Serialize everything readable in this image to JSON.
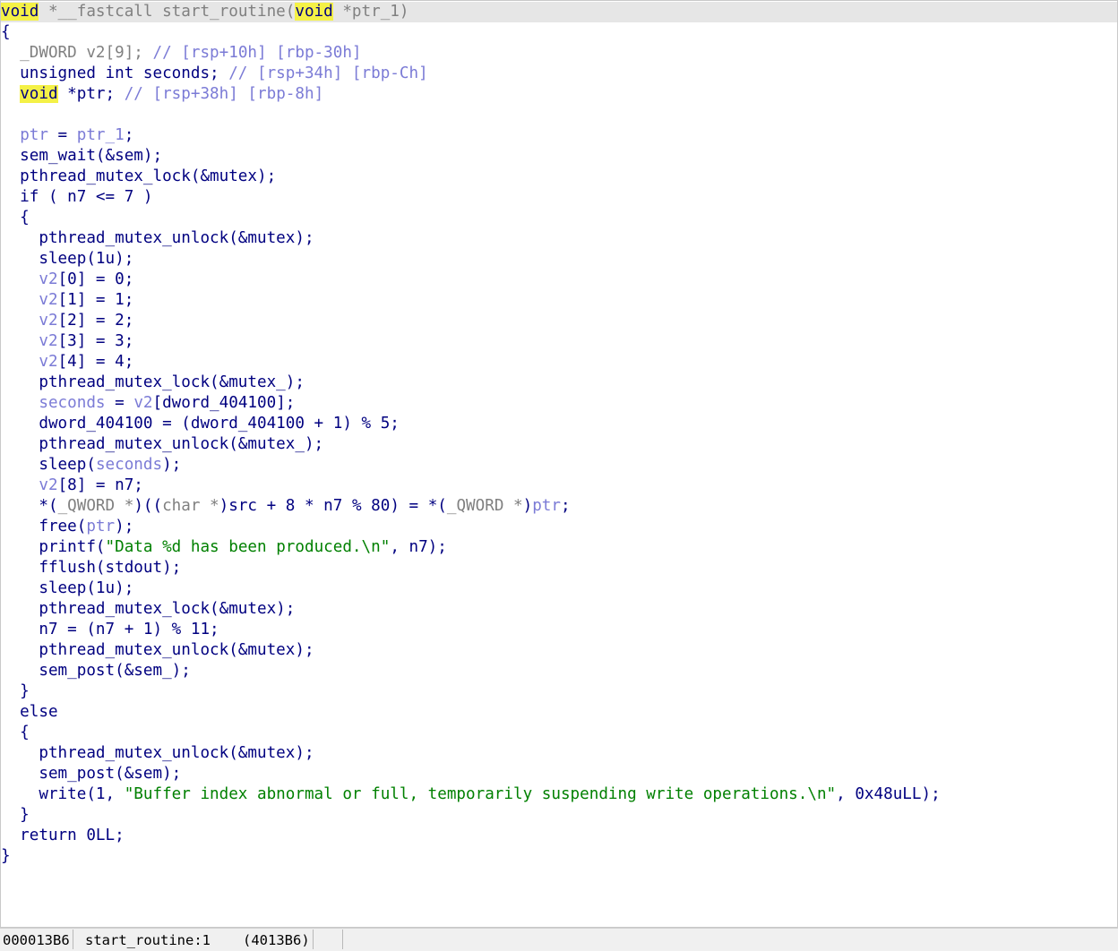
{
  "editor": {
    "lines": [
      [
        {
          "t": "void",
          "c": "hl"
        },
        {
          "t": " *__fastcall start_routine(",
          "c": "t-gray"
        },
        {
          "t": "void",
          "c": "hl"
        },
        {
          "t": " *ptr_1)",
          "c": "t-gray"
        }
      ],
      [
        {
          "t": "{",
          "c": "t-c"
        }
      ],
      [
        {
          "t": "  _DWORD v2[9]; ",
          "c": "t-gray"
        },
        {
          "t": "// [rsp+10h] [rbp-30h]",
          "c": "t-cm"
        }
      ],
      [
        {
          "t": "  unsigned int seconds; ",
          "c": "t-c"
        },
        {
          "t": "// [rsp+34h] [rbp-Ch]",
          "c": "t-cm"
        }
      ],
      [
        {
          "t": "  ",
          "c": "t-c"
        },
        {
          "t": "void",
          "c": "hl"
        },
        {
          "t": " *ptr; ",
          "c": "t-c"
        },
        {
          "t": "// [rsp+38h] [rbp-8h]",
          "c": "t-cm"
        }
      ],
      [
        {
          "t": "",
          "c": "t-c"
        }
      ],
      [
        {
          "t": "  ",
          "c": "t-c"
        },
        {
          "t": "ptr",
          "c": "t-var"
        },
        {
          "t": " = ",
          "c": "t-c"
        },
        {
          "t": "ptr_1",
          "c": "t-var"
        },
        {
          "t": ";",
          "c": "t-c"
        }
      ],
      [
        {
          "t": "  sem_wait(&sem);",
          "c": "t-c"
        }
      ],
      [
        {
          "t": "  pthread_mutex_lock(&mutex);",
          "c": "t-c"
        }
      ],
      [
        {
          "t": "  if ( n7 <= 7 )",
          "c": "t-c"
        }
      ],
      [
        {
          "t": "  {",
          "c": "t-c"
        }
      ],
      [
        {
          "t": "    pthread_mutex_unlock(&mutex);",
          "c": "t-c"
        }
      ],
      [
        {
          "t": "    sleep(1u);",
          "c": "t-c"
        }
      ],
      [
        {
          "t": "    ",
          "c": "t-c"
        },
        {
          "t": "v2",
          "c": "t-var"
        },
        {
          "t": "[0] = 0;",
          "c": "t-c"
        }
      ],
      [
        {
          "t": "    ",
          "c": "t-c"
        },
        {
          "t": "v2",
          "c": "t-var"
        },
        {
          "t": "[1] = 1;",
          "c": "t-c"
        }
      ],
      [
        {
          "t": "    ",
          "c": "t-c"
        },
        {
          "t": "v2",
          "c": "t-var"
        },
        {
          "t": "[2] = 2;",
          "c": "t-c"
        }
      ],
      [
        {
          "t": "    ",
          "c": "t-c"
        },
        {
          "t": "v2",
          "c": "t-var"
        },
        {
          "t": "[3] = 3;",
          "c": "t-c"
        }
      ],
      [
        {
          "t": "    ",
          "c": "t-c"
        },
        {
          "t": "v2",
          "c": "t-var"
        },
        {
          "t": "[4] = 4;",
          "c": "t-c"
        }
      ],
      [
        {
          "t": "    pthread_mutex_lock(&mutex_);",
          "c": "t-c"
        }
      ],
      [
        {
          "t": "    ",
          "c": "t-c"
        },
        {
          "t": "seconds",
          "c": "t-var"
        },
        {
          "t": " = ",
          "c": "t-c"
        },
        {
          "t": "v2",
          "c": "t-var"
        },
        {
          "t": "[dword_404100];",
          "c": "t-c"
        }
      ],
      [
        {
          "t": "    dword_404100 = (dword_404100 + 1) % 5;",
          "c": "t-c"
        }
      ],
      [
        {
          "t": "    pthread_mutex_unlock(&mutex_);",
          "c": "t-c"
        }
      ],
      [
        {
          "t": "    sleep(",
          "c": "t-c"
        },
        {
          "t": "seconds",
          "c": "t-var"
        },
        {
          "t": ");",
          "c": "t-c"
        }
      ],
      [
        {
          "t": "    ",
          "c": "t-c"
        },
        {
          "t": "v2",
          "c": "t-var"
        },
        {
          "t": "[8] = n7;",
          "c": "t-c"
        }
      ],
      [
        {
          "t": "    *(",
          "c": "t-c"
        },
        {
          "t": "_QWORD *",
          "c": "t-gray"
        },
        {
          "t": ")((",
          "c": "t-c"
        },
        {
          "t": "char *",
          "c": "t-gray"
        },
        {
          "t": ")src + 8 * n7 % 80) = *(",
          "c": "t-c"
        },
        {
          "t": "_QWORD *",
          "c": "t-gray"
        },
        {
          "t": ")",
          "c": "t-c"
        },
        {
          "t": "ptr",
          "c": "t-var"
        },
        {
          "t": ";",
          "c": "t-c"
        }
      ],
      [
        {
          "t": "    free(",
          "c": "t-c"
        },
        {
          "t": "ptr",
          "c": "t-var"
        },
        {
          "t": ");",
          "c": "t-c"
        }
      ],
      [
        {
          "t": "    printf(",
          "c": "t-c"
        },
        {
          "t": "\"Data %d has been produced.\\n\"",
          "c": "t-str"
        },
        {
          "t": ", n7);",
          "c": "t-c"
        }
      ],
      [
        {
          "t": "    fflush(stdout);",
          "c": "t-c"
        }
      ],
      [
        {
          "t": "    sleep(1u);",
          "c": "t-c"
        }
      ],
      [
        {
          "t": "    pthread_mutex_lock(&mutex);",
          "c": "t-c"
        }
      ],
      [
        {
          "t": "    n7 = (n7 + 1) % 11;",
          "c": "t-c"
        }
      ],
      [
        {
          "t": "    pthread_mutex_unlock(&mutex);",
          "c": "t-c"
        }
      ],
      [
        {
          "t": "    sem_post(&sem_);",
          "c": "t-c"
        }
      ],
      [
        {
          "t": "  }",
          "c": "t-c"
        }
      ],
      [
        {
          "t": "  else",
          "c": "t-c"
        }
      ],
      [
        {
          "t": "  {",
          "c": "t-c"
        }
      ],
      [
        {
          "t": "    pthread_mutex_unlock(&mutex);",
          "c": "t-c"
        }
      ],
      [
        {
          "t": "    sem_post(&sem);",
          "c": "t-c"
        }
      ],
      [
        {
          "t": "    write(1, ",
          "c": "t-c"
        },
        {
          "t": "\"Buffer index abnormal or full, temporarily suspending write operations.\\n\"",
          "c": "t-str"
        },
        {
          "t": ", 0x48uLL);",
          "c": "t-c"
        }
      ],
      [
        {
          "t": "  }",
          "c": "t-c"
        }
      ],
      [
        {
          "t": "  return 0LL;",
          "c": "t-c"
        }
      ],
      [
        {
          "t": "}",
          "c": "t-c"
        }
      ]
    ]
  },
  "status_bar": {
    "address": "000013B6",
    "location": "start_routine:1",
    "va": "(4013B6)"
  }
}
